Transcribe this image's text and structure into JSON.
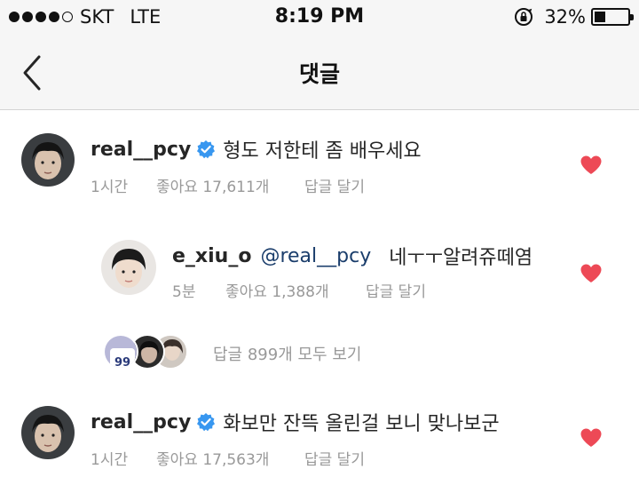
{
  "status_bar": {
    "carrier": "SKT",
    "network": "LTE",
    "time": "8:19 PM",
    "battery_percent_text": "32%",
    "battery_level": 0.32,
    "signal_bars_filled": 4,
    "signal_bars_total": 5
  },
  "nav": {
    "title": "댓글",
    "back_icon": "chevron-left-icon"
  },
  "comments": [
    {
      "username": "real__pcy",
      "verified": true,
      "text": "형도 저한테 좀 배우세요",
      "time": "1시간",
      "likes": "좋아요 17,611개",
      "reply_label": "답글 달기",
      "liked": true
    },
    {
      "username": "e_xiu_o",
      "mention": "@real__pcy",
      "text": "네ㅜㅜ알려쥬떼염",
      "time": "5분",
      "likes": "좋아요 1,388개",
      "reply_label": "답글 달기",
      "liked": true
    },
    {
      "username": "real__pcy",
      "verified": true,
      "text": "화보만 잔뜩 올린걸 보니 맞나보군",
      "time": "1시간",
      "likes": "좋아요 17,563개",
      "reply_label": "답글 달기",
      "liked": true
    }
  ],
  "replies_summary": {
    "label": "답글 899개 모두 보기",
    "jersey_number": "99"
  },
  "colors": {
    "heart": "#ed4956",
    "verified": "#3897f0",
    "mention": "#1a3d6b",
    "meta": "#999999",
    "bar_background": "#f6f6f6"
  }
}
